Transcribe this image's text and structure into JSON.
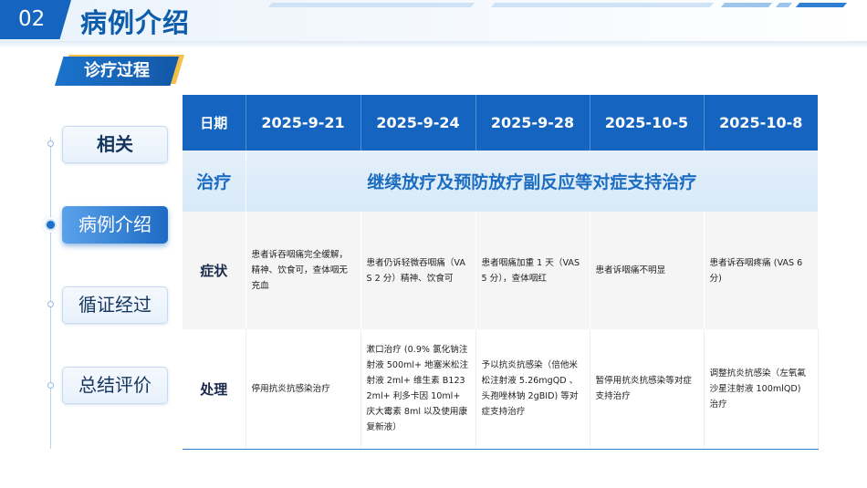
{
  "header": {
    "section_number": "02",
    "title": "病例介绍"
  },
  "subtitle": "诊疗过程",
  "nav": {
    "items": [
      {
        "label": "相关"
      },
      {
        "label": "病例介绍"
      },
      {
        "label": "循证经过"
      },
      {
        "label": "总结评价"
      }
    ],
    "active_index": 1
  },
  "table": {
    "header": [
      "日期",
      "2025-9-21",
      "2025-9-24",
      "2025-9-28",
      "2025-10-5",
      "2025-10-8"
    ],
    "treatment": {
      "label": "治疗",
      "value": "继续放疗及预防放疗副反应等对症支持治疗"
    },
    "symptoms": {
      "label": "症状",
      "cells": [
        "患者诉吞咽痛完全缓解，精神、饮食可，查体咽无充血",
        "患者仍诉轻微吞咽痛（VAS 2 分）精神、饮食可",
        "患者咽痛加重 1 天（VAS5 分），查体咽红",
        "患者诉咽痛不明显",
        "患者诉吞咽疼痛 (VAS 6 分)"
      ]
    },
    "management": {
      "label": "处理",
      "cells": [
        "停用抗炎抗感染治疗",
        "漱口治疗 (0.9% 氯化钠注射液 500ml+ 地塞米松注射液 2ml+ 维生素 B1232ml+ 利多卡因 10ml+ 庆大霉素 8ml 以及使用康复新液）",
        "予以抗炎抗感染（倍他米松注射液 5.26mgQD 、头孢唑林钠 2gBID) 等对症支持治疗",
        "暂停用抗炎抗感染等对症支持治疗",
        "调整抗炎抗感染（左氧氟沙星注射液 100mlQD) 治疗"
      ]
    }
  },
  "colors": {
    "primary_blue": "#1565c0",
    "accent_yellow": "#f2c14a",
    "treatment_text": "#1c6dc2"
  }
}
